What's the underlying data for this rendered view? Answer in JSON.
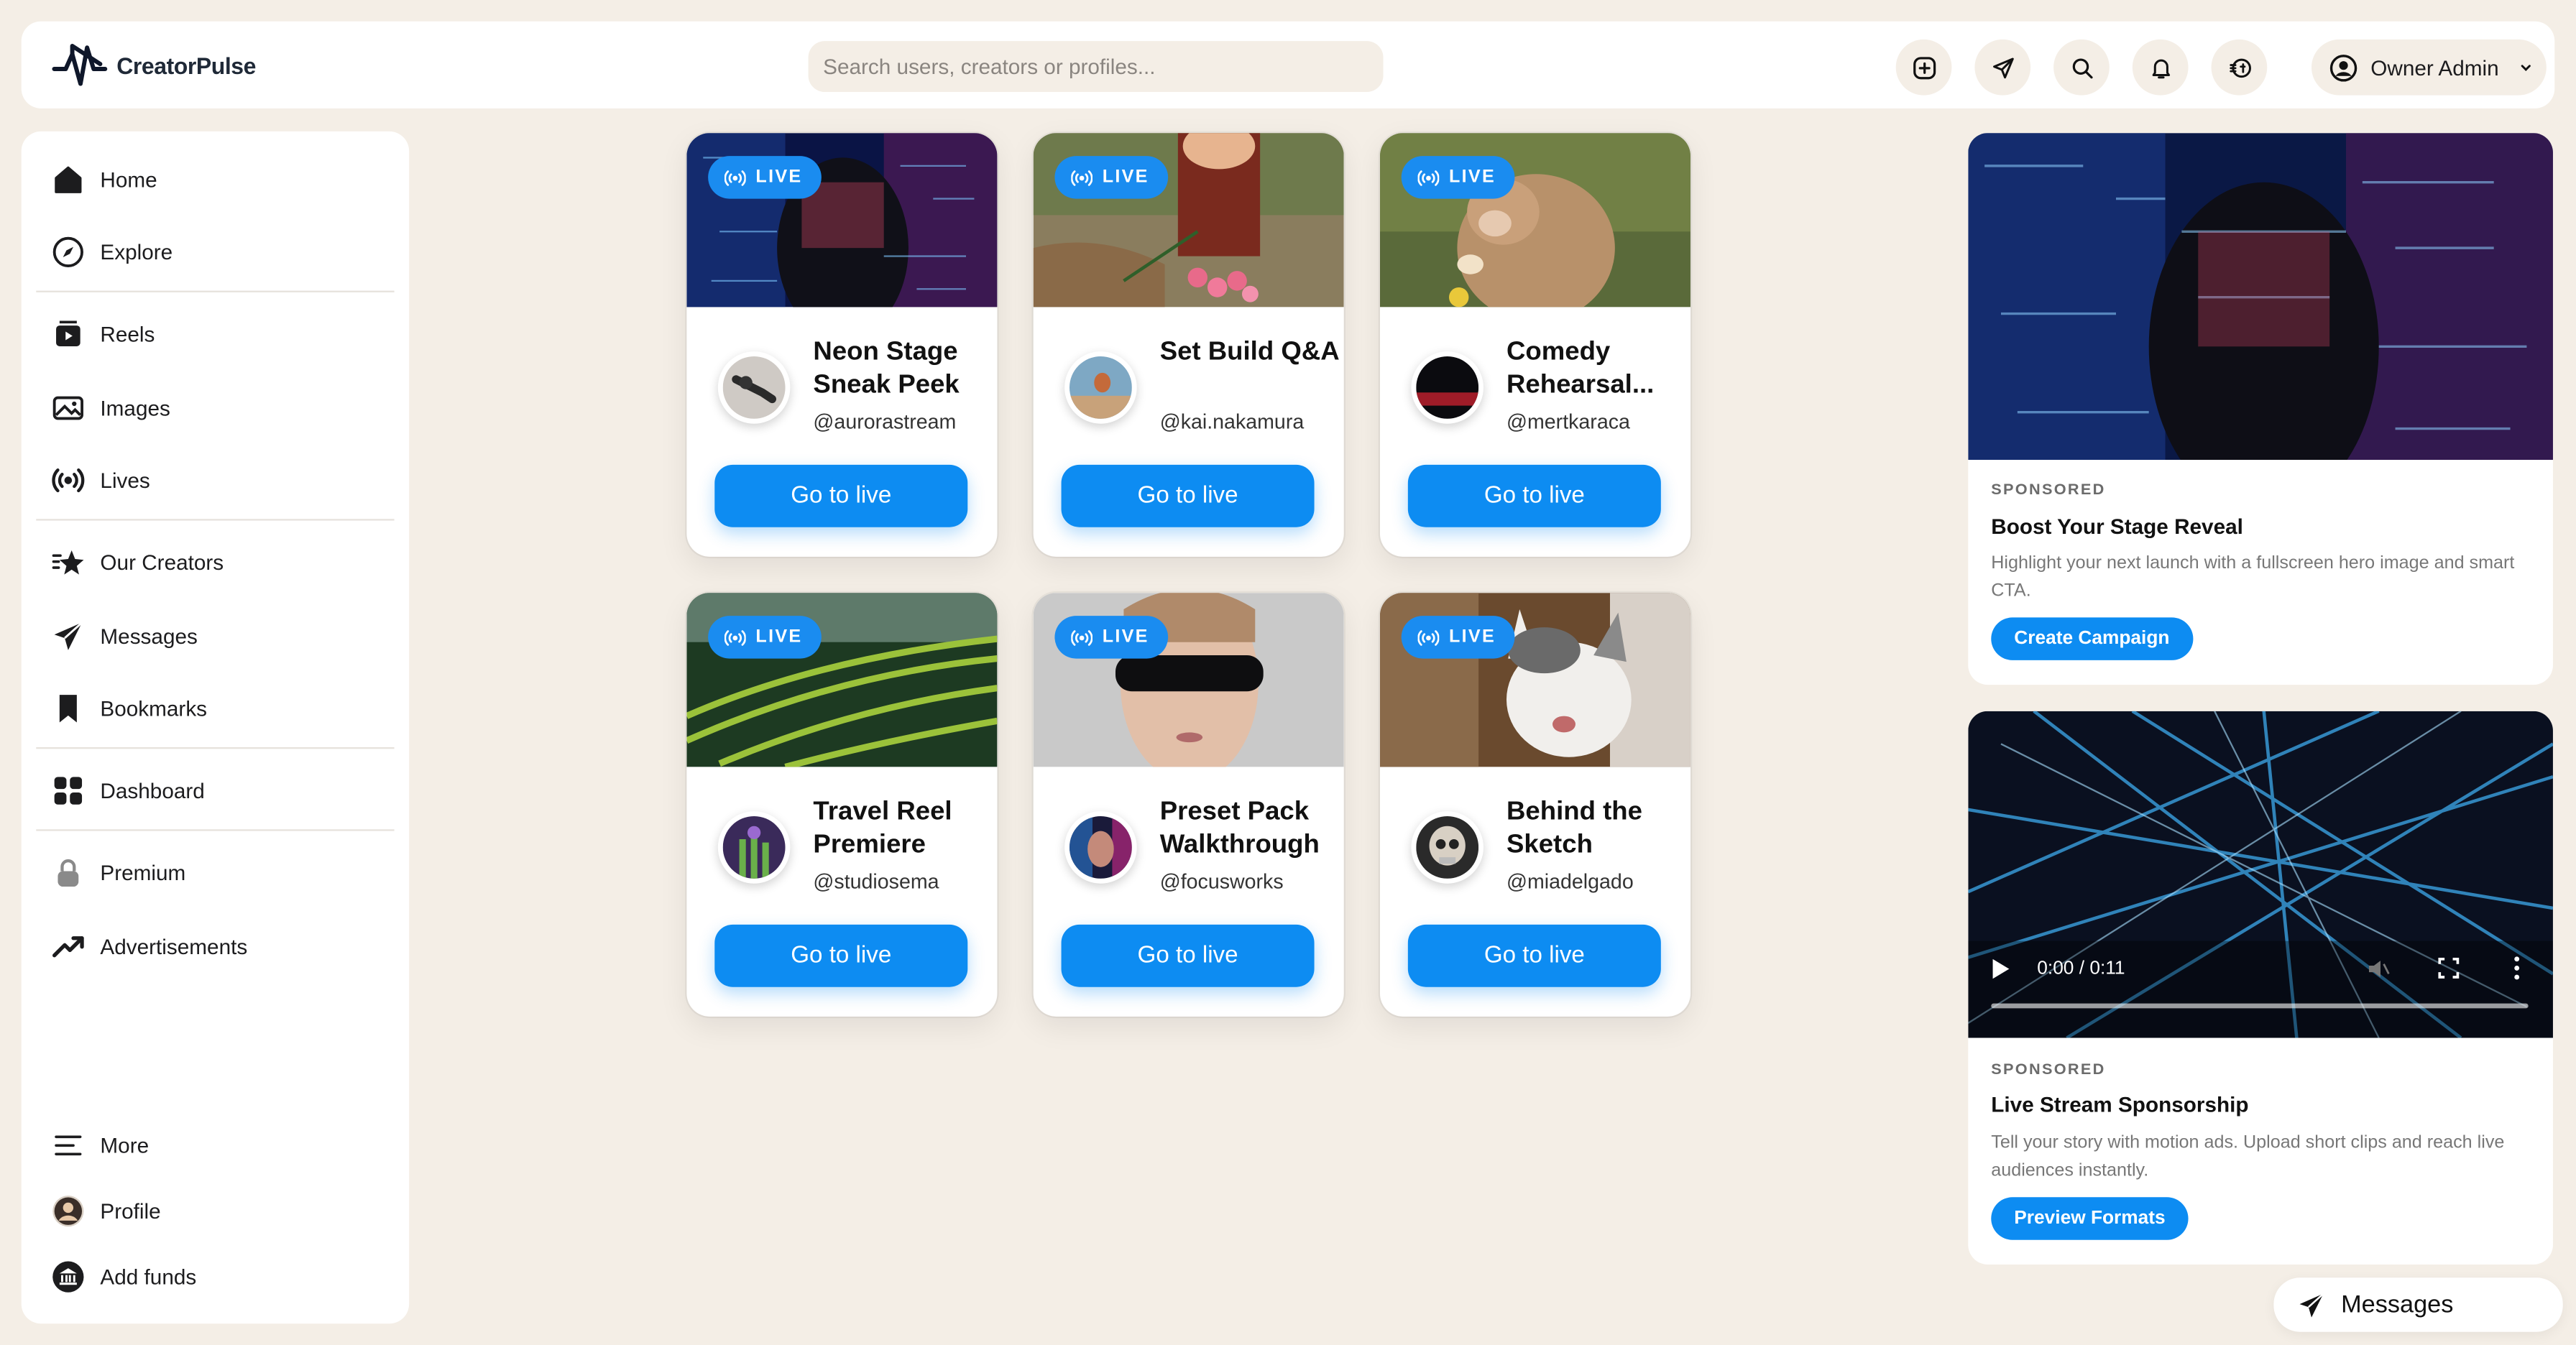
{
  "brand": {
    "name": "CreatorPulse"
  },
  "search": {
    "placeholder": "Search users, creators or profiles..."
  },
  "header": {
    "icons": [
      "plus-square-icon",
      "send-icon",
      "search-icon",
      "bell-icon",
      "coins-icon"
    ],
    "account_name": "Owner Admin"
  },
  "sidebar": {
    "items": [
      {
        "label": "Home",
        "icon": "home-icon"
      },
      {
        "label": "Explore",
        "icon": "compass-icon"
      },
      {
        "label": "Reels",
        "icon": "reels-icon"
      },
      {
        "label": "Images",
        "icon": "image-icon"
      },
      {
        "label": "Lives",
        "icon": "broadcast-icon"
      },
      {
        "label": "Our Creators",
        "icon": "star-icon"
      },
      {
        "label": "Messages",
        "icon": "send-icon"
      },
      {
        "label": "Bookmarks",
        "icon": "bookmark-icon"
      },
      {
        "label": "Dashboard",
        "icon": "grid-icon"
      },
      {
        "label": "Premium",
        "icon": "lock-icon"
      },
      {
        "label": "Advertisements",
        "icon": "trending-icon"
      },
      {
        "label": "More",
        "icon": "menu-icon"
      },
      {
        "label": "Profile",
        "icon": "avatar-icon"
      },
      {
        "label": "Add funds",
        "icon": "bank-icon"
      }
    ]
  },
  "lives": {
    "badge": "LIVE",
    "button_label": "Go to live",
    "cards": [
      {
        "title": "Neon Stage Sneak Peek",
        "handle": "@aurorastream"
      },
      {
        "title": "Set Build Q&A",
        "handle": "@kai.nakamura"
      },
      {
        "title": "Comedy Rehearsal...",
        "handle": "@mertkaraca"
      },
      {
        "title": "Travel Reel Premiere",
        "handle": "@studiosema"
      },
      {
        "title": "Preset Pack Walkthrough",
        "handle": "@focusworks"
      },
      {
        "title": "Behind the Sketch",
        "handle": "@miadelgado"
      }
    ]
  },
  "ads": [
    {
      "label": "SPONSORED",
      "title": "Boost Your Stage Reveal",
      "description": "Highlight your next launch with a fullscreen hero image and smart CTA.",
      "button": "Create Campaign"
    },
    {
      "label": "SPONSORED",
      "title": "Live Stream Sponsorship",
      "description": "Tell your story with motion ads. Upload short clips and reach live audiences instantly.",
      "button": "Preview Formats",
      "video_time": "0:00 / 0:11",
      "video_progress": 0
    }
  ],
  "messages_bar": {
    "label": "Messages"
  },
  "colors": {
    "accent": "#0d8cf2",
    "background": "#f4eee6",
    "panel": "#ffffff"
  }
}
